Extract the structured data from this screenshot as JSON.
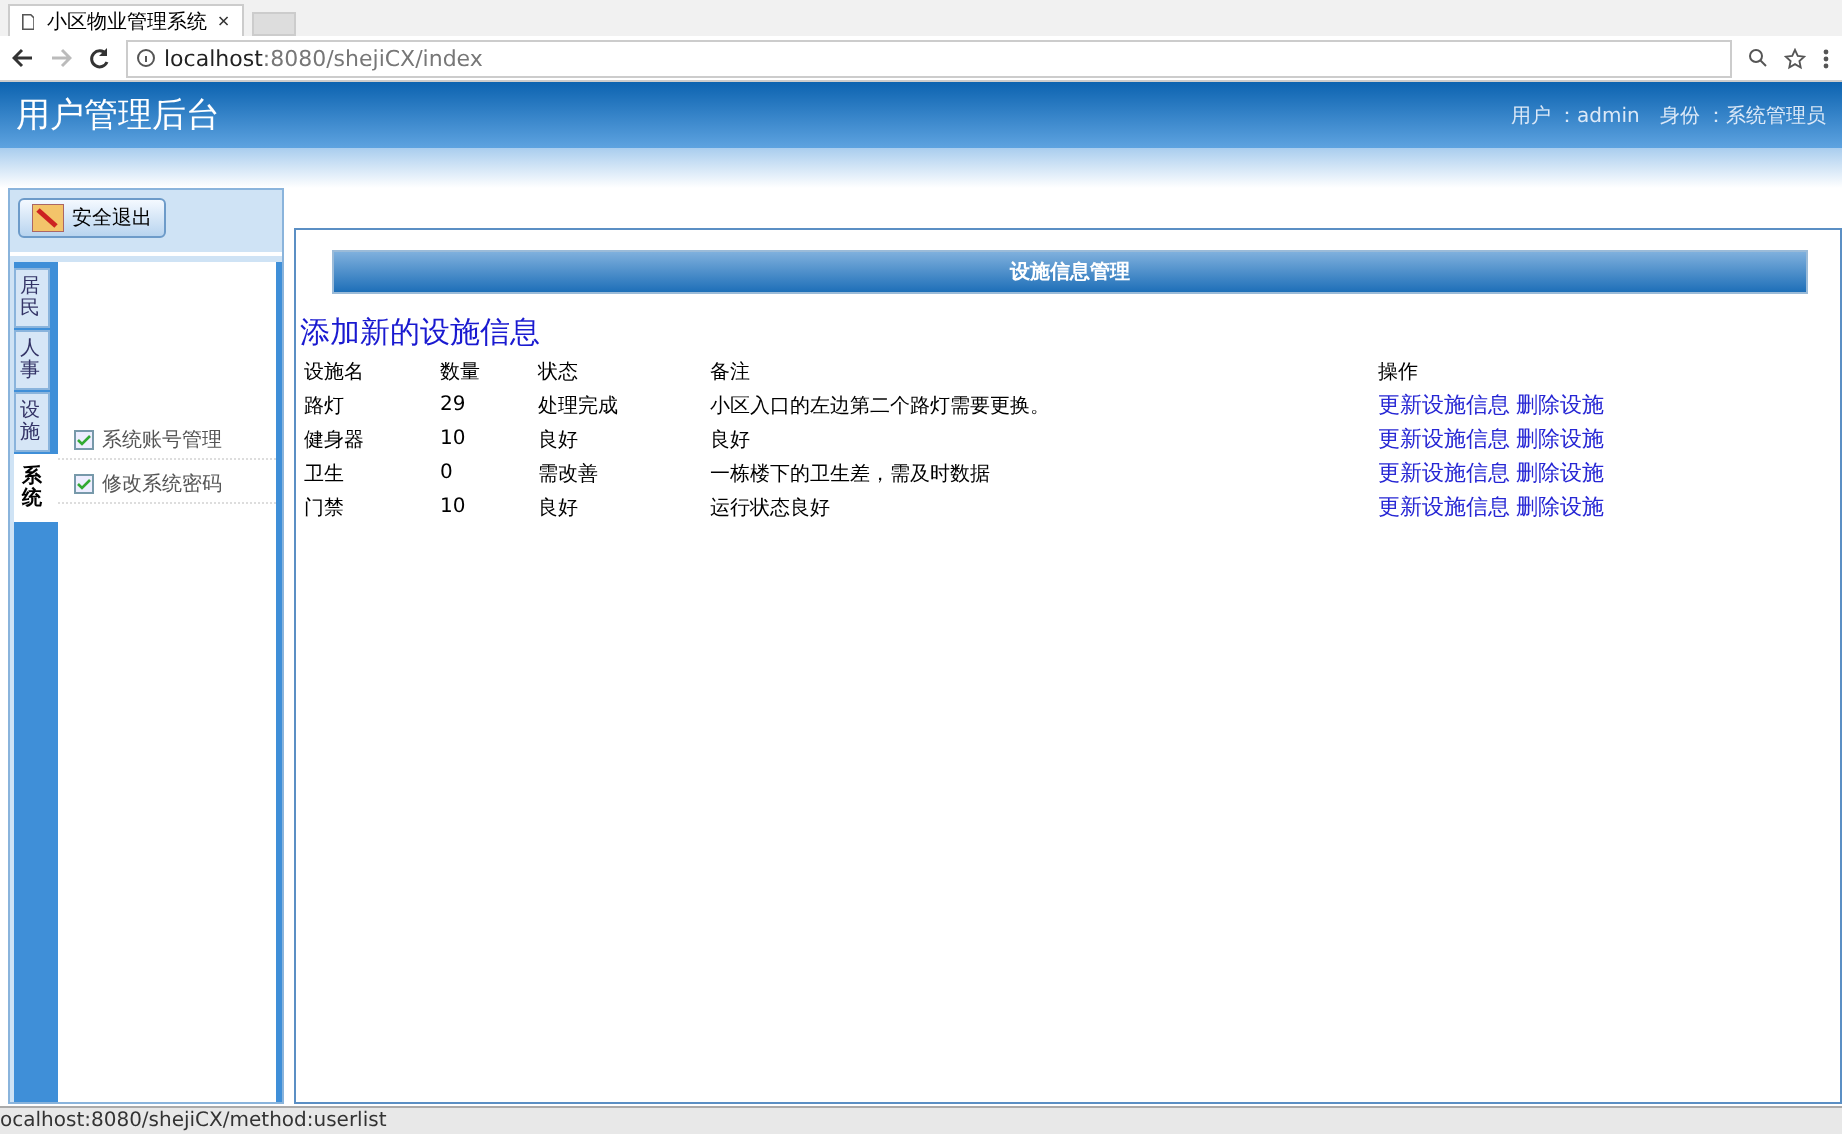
{
  "browser": {
    "tab_title": "小区物业管理系统",
    "url_host": "localhost",
    "url_path": ":8080/shejiCX/index",
    "status_url": "ocalhost:8080/shejiCX/method:userlist"
  },
  "header": {
    "title": "用户管理后台",
    "user": "用户 ：admin",
    "role": "身份 ：系统管理员"
  },
  "sidebar": {
    "logout": "安全退出",
    "tabs": [
      {
        "label": "居民",
        "selected": false
      },
      {
        "label": "人事",
        "selected": false
      },
      {
        "label": "设施",
        "selected": false
      },
      {
        "label": "系统",
        "selected": true
      }
    ],
    "menu": [
      {
        "label": "系统账号管理"
      },
      {
        "label": "修改系统密码"
      }
    ]
  },
  "panel": {
    "title": "设施信息管理",
    "heading": "添加新的设施信息",
    "columns": [
      "设施名",
      "数量",
      "状态",
      "备注",
      "操作"
    ],
    "rows": [
      {
        "cells": [
          "路灯",
          "29",
          "处理完成",
          "小区入口的左边第二个路灯需要更换。"
        ],
        "actions": [
          "更新设施信息",
          "删除设施"
        ]
      },
      {
        "cells": [
          "健身器",
          "10",
          "良好",
          "良好"
        ],
        "actions": [
          "更新设施信息",
          "删除设施"
        ]
      },
      {
        "cells": [
          "卫生",
          "0",
          "需改善",
          "一栋楼下的卫生差，需及时数据"
        ],
        "actions": [
          "更新设施信息",
          "删除设施"
        ]
      },
      {
        "cells": [
          "门禁",
          "10",
          "良好",
          "运行状态良好"
        ],
        "actions": [
          "更新设施信息",
          "删除设施"
        ]
      }
    ]
  }
}
